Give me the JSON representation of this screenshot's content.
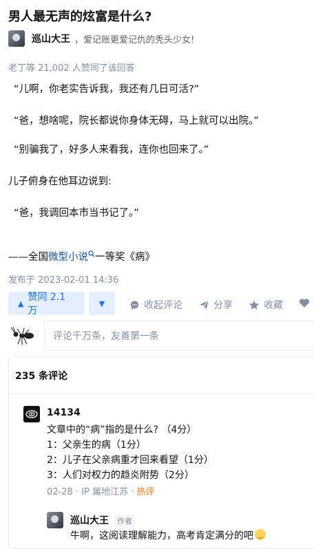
{
  "question": {
    "title": "男人最无声的炫富是什么?"
  },
  "author": {
    "name": "巡山大王",
    "bio": "，爱记账更爱记仇的秃头少女!"
  },
  "vote_summary": "老丁等 21,002 人赞同了该回答",
  "content": {
    "p1": "“儿啊，你老实告诉我，我还有几日可活?”",
    "p2": "“爸，想啥呢，院长都说你身体无碍，马上就可以出院。”",
    "p3": "“别骗我了，好多人来看我，连你也回来了。”",
    "p4": "儿子俯身在他耳边说到:",
    "p5": "“爸，我调回本市当书记了。”",
    "footer_prefix": "——全国",
    "footer_link": "微型小说",
    "footer_suffix": "一等奖《病》"
  },
  "publish_time": "发布于 2023-02-01 14:36",
  "actions": {
    "upvote_label": "赞同 2.1 万",
    "comment_label": "收起评论",
    "share_label": "分享",
    "favorite_label": "收藏"
  },
  "comment_input": {
    "placeholder": "评论千万条，友善第一条"
  },
  "comments": {
    "count_label": "235 条评论",
    "items": [
      {
        "user": "14134",
        "lines": [
          "文章中的“病”指的是什么? （4分）",
          "1：父亲生的病（1分）",
          "2：儿子在父亲病重才回来看望（1分）",
          "3：人们对权力的趋炎附势（2分）"
        ],
        "date": "02-28",
        "location": "IP 属地江苏",
        "tag": "热评"
      },
      {
        "user": "巡山大王",
        "badge": "作者",
        "text": "牛啊，这阅读理解能力，高考肯定满分的吧"
      }
    ]
  },
  "colors": {
    "brand_blue": "#1772f6",
    "meta_gray": "#8590a6",
    "hot_orange": "#ff761a",
    "link_blue": "#175199"
  }
}
